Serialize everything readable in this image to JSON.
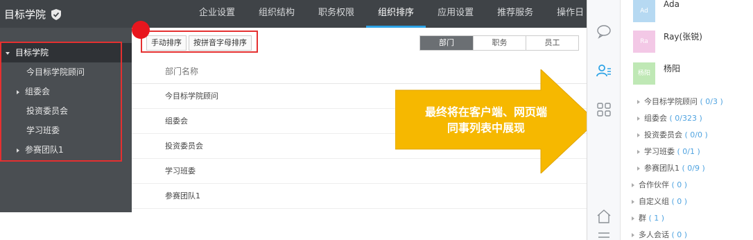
{
  "brand": {
    "name": "目标学院"
  },
  "nav": {
    "items": [
      "企业设置",
      "组织结构",
      "职务权限",
      "组织排序",
      "应用设置",
      "推荐服务",
      "操作日"
    ],
    "active_index": 3
  },
  "sidebar": {
    "root": "目标学院",
    "items": [
      {
        "label": "今目标学院顾问",
        "expandable": false
      },
      {
        "label": "组委会",
        "expandable": true
      },
      {
        "label": "投资委员会",
        "expandable": false
      },
      {
        "label": "学习班委",
        "expandable": false
      },
      {
        "label": "参赛团队1",
        "expandable": true
      }
    ]
  },
  "toolbar": {
    "manual_sort": "手动排序",
    "pinyin_sort": "按拼音字母排序"
  },
  "segment": {
    "options": [
      "部门",
      "职务",
      "员工"
    ],
    "active": "部门"
  },
  "table": {
    "header": "部门名称",
    "rows": [
      "今目标学院顾问",
      "组委会",
      "投资委员会",
      "学习班委",
      "参赛团队1"
    ]
  },
  "callout": {
    "line1": "最终将在客户端、网页端",
    "line2": "同事列表中展现",
    "color": "#f6b800"
  },
  "client": {
    "contacts": [
      {
        "avatar": "Ad",
        "name": "Ada",
        "color": "#b6d9f2"
      },
      {
        "avatar": "Ra",
        "name": "Ray(张锐)",
        "color": "#f3c8e6"
      },
      {
        "avatar": "杨阳",
        "name": "杨阳",
        "color": "#bfe8b5"
      }
    ],
    "sub_groups": [
      {
        "name": "今目标学院顾问",
        "count": "( 0/3 )"
      },
      {
        "name": "组委会",
        "count": "( 0/323 )"
      },
      {
        "name": "投资委员会",
        "count": "( 0/0 )"
      },
      {
        "name": "学习班委",
        "count": "( 0/1 )"
      },
      {
        "name": "参赛团队1",
        "count": "( 0/9 )"
      }
    ],
    "groups": [
      {
        "name": "合作伙伴",
        "count": "( 0 )"
      },
      {
        "name": "自定义组",
        "count": "( 0 )"
      },
      {
        "name": "群",
        "count": "( 1 )"
      },
      {
        "name": "多人会话",
        "count": "( 0 )"
      }
    ]
  },
  "colors": {
    "accent": "#2da3e6",
    "highlight_red": "#e53030"
  }
}
